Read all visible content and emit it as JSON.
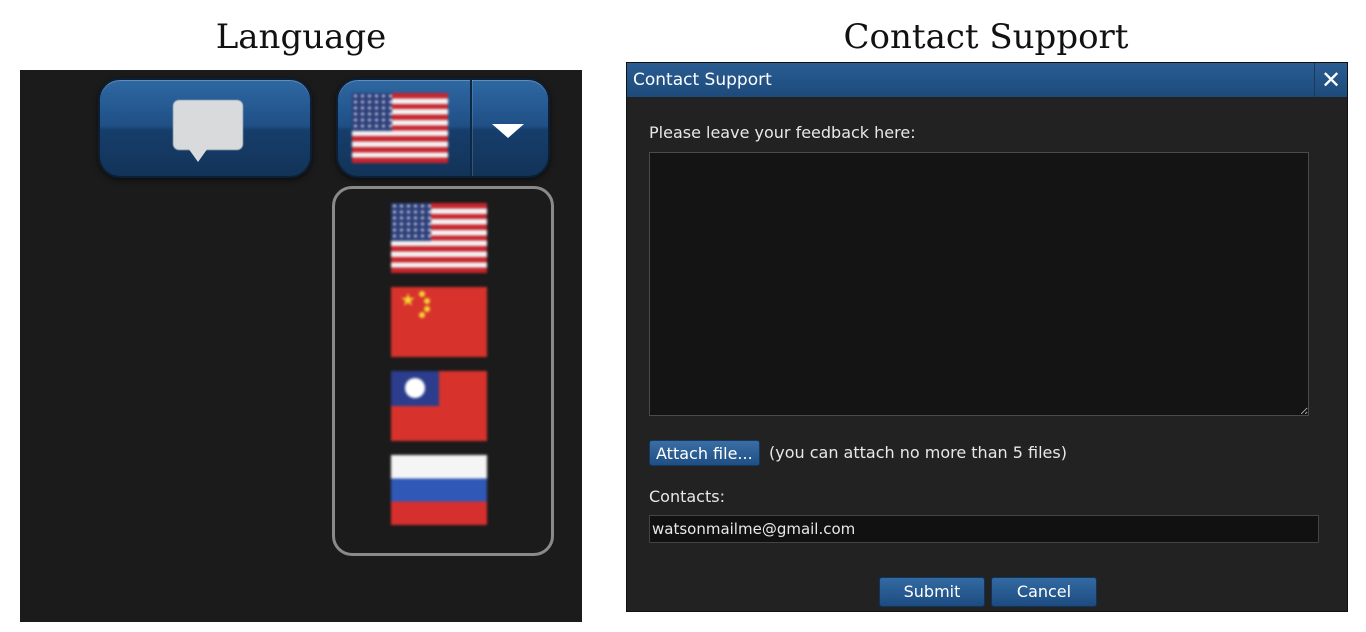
{
  "captions": {
    "language": "Language",
    "contact": "Contact Support"
  },
  "language_panel": {
    "speech_button_icon": "speech-bubble-icon",
    "selected_flag": "us-flag",
    "dropdown_icon": "triangle-down-icon",
    "flags": [
      "us-flag",
      "china-flag",
      "taiwan-flag",
      "russia-flag"
    ]
  },
  "contact_dialog": {
    "title": "Contact Support",
    "close_icon": "close-icon",
    "feedback_label": "Please leave your feedback here:",
    "feedback_value": "",
    "attach_button": "Attach file...",
    "attach_note": "(you can attach no more than 5 files)",
    "contacts_label": "Contacts:",
    "contacts_value": "watsonmailme@gmail.com",
    "submit_button": "Submit",
    "cancel_button": "Cancel"
  },
  "colors": {
    "panel_bg": "#1b1b1b",
    "button_blue": "#1f4f85",
    "titlebar_blue": "#2a5d92"
  }
}
